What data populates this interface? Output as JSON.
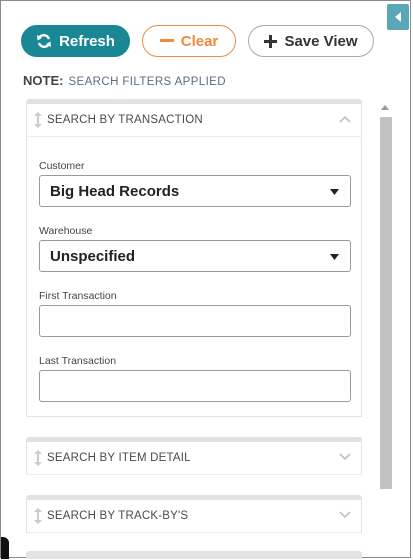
{
  "toolbar": {
    "refresh_label": "Refresh",
    "clear_label": "Clear",
    "save_view_label": "Save View"
  },
  "note": {
    "label": "NOTE:",
    "text": "SEARCH FILTERS APPLIED"
  },
  "panels": {
    "transaction": {
      "title": "SEARCH BY TRANSACTION",
      "expanded": true,
      "customer_label": "Customer",
      "customer_value": "Big Head Records",
      "warehouse_label": "Warehouse",
      "warehouse_value": "Unspecified",
      "first_transaction_label": "First Transaction",
      "first_transaction_value": "",
      "last_transaction_label": "Last Transaction",
      "last_transaction_value": ""
    },
    "item_detail": {
      "title": "SEARCH BY ITEM DETAIL",
      "expanded": false
    },
    "track_by": {
      "title": "SEARCH BY TRACK-BY'S",
      "expanded": false
    }
  },
  "colors": {
    "primary": "#1a8794",
    "clear_accent": "#ef8a3e",
    "collapse_tab": "#5aa8b5",
    "note_text": "#5b6d80"
  },
  "icons": {
    "refresh": "refresh-icon",
    "clear": "minus-icon",
    "save_view": "plus-icon",
    "collapse": "caret-left-icon",
    "drag": "drag-handle-icon",
    "expand": "chevron-icon",
    "dropdown": "caret-down-icon"
  }
}
